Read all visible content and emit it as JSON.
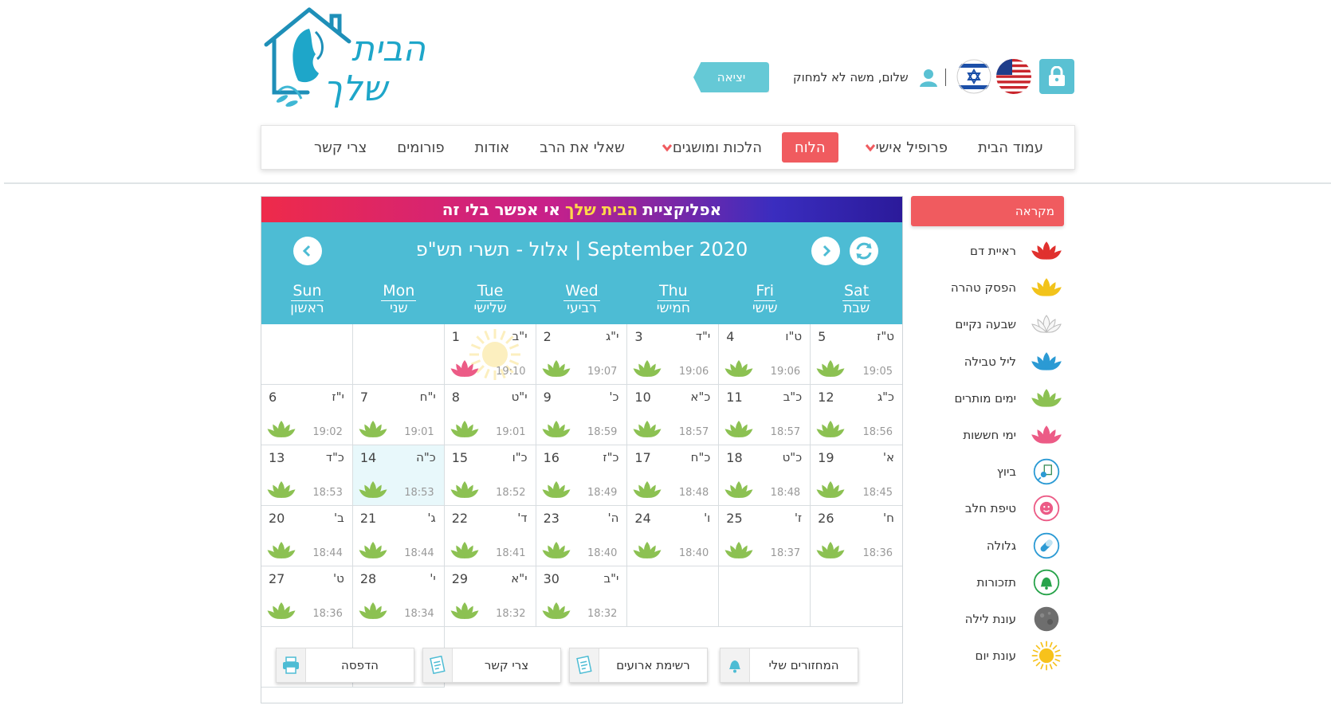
{
  "header": {
    "logo_text_1": "הבית",
    "logo_text_2": "שלך",
    "logout_label": "יציאה",
    "greeting": "שלום, משה לא למחוק"
  },
  "nav": [
    {
      "label": "עמוד הבית",
      "dropdown": false,
      "active": false
    },
    {
      "label": "פרופיל אישי",
      "dropdown": true,
      "active": false
    },
    {
      "label": "הלוח",
      "dropdown": false,
      "active": true
    },
    {
      "label": "הלכות ומושגים",
      "dropdown": true,
      "active": false
    },
    {
      "label": "שאלי את הרב",
      "dropdown": false,
      "active": false
    },
    {
      "label": "אודות",
      "dropdown": false,
      "active": false
    },
    {
      "label": "פורומים",
      "dropdown": false,
      "active": false
    },
    {
      "label": "צרי קשר",
      "dropdown": false,
      "active": false
    }
  ],
  "colors": {
    "accent": "#f05b5f",
    "calendar_header": "#4dbcd4",
    "lotus_green": "#8cc152"
  },
  "banner": {
    "part1": "אפליקציית",
    "highlight": "הבית שלך",
    "part2": "אי אפשר בלי זה"
  },
  "calendar": {
    "title": "אלול - תשרי תש\"פ | September 2020",
    "weekdays": [
      {
        "en": "Sun",
        "he": "ראשון"
      },
      {
        "en": "Mon",
        "he": "שני"
      },
      {
        "en": "Tue",
        "he": "שלישי"
      },
      {
        "en": "Wed",
        "he": "רביעי"
      },
      {
        "en": "Thu",
        "he": "חמישי"
      },
      {
        "en": "Fri",
        "he": "שישי"
      },
      {
        "en": "Sat",
        "he": "שבת"
      }
    ],
    "cells": [
      {
        "empty": true
      },
      {
        "empty": true
      },
      {
        "day": "1",
        "heb": "י\"ב",
        "time": "19:10",
        "lotus": "pink",
        "sun": true
      },
      {
        "day": "2",
        "heb": "י\"ג",
        "time": "19:07",
        "lotus": "green"
      },
      {
        "day": "3",
        "heb": "י\"ד",
        "time": "19:06",
        "lotus": "green"
      },
      {
        "day": "4",
        "heb": "ט\"ו",
        "time": "19:06",
        "lotus": "green"
      },
      {
        "day": "5",
        "heb": "ט\"ז",
        "time": "19:05",
        "lotus": "green"
      },
      {
        "day": "6",
        "heb": "י\"ז",
        "time": "19:02",
        "lotus": "green"
      },
      {
        "day": "7",
        "heb": "י\"ח",
        "time": "19:01",
        "lotus": "green"
      },
      {
        "day": "8",
        "heb": "י\"ט",
        "time": "19:01",
        "lotus": "green"
      },
      {
        "day": "9",
        "heb": "כ'",
        "time": "18:59",
        "lotus": "green"
      },
      {
        "day": "10",
        "heb": "כ\"א",
        "time": "18:57",
        "lotus": "green"
      },
      {
        "day": "11",
        "heb": "כ\"ב",
        "time": "18:57",
        "lotus": "green"
      },
      {
        "day": "12",
        "heb": "כ\"ג",
        "time": "18:56",
        "lotus": "green"
      },
      {
        "day": "13",
        "heb": "כ\"ד",
        "time": "18:53",
        "lotus": "green"
      },
      {
        "day": "14",
        "heb": "כ\"ה",
        "time": "18:53",
        "lotus": "green",
        "today": true
      },
      {
        "day": "15",
        "heb": "כ\"ו",
        "time": "18:52",
        "lotus": "green"
      },
      {
        "day": "16",
        "heb": "כ\"ז",
        "time": "18:49",
        "lotus": "green"
      },
      {
        "day": "17",
        "heb": "כ\"ח",
        "time": "18:48",
        "lotus": "green"
      },
      {
        "day": "18",
        "heb": "כ\"ט",
        "time": "18:48",
        "lotus": "green"
      },
      {
        "day": "19",
        "heb": "א'",
        "time": "18:45",
        "lotus": "green"
      },
      {
        "day": "20",
        "heb": "ב'",
        "time": "18:44",
        "lotus": "green"
      },
      {
        "day": "21",
        "heb": "ג'",
        "time": "18:44",
        "lotus": "green"
      },
      {
        "day": "22",
        "heb": "ד'",
        "time": "18:41",
        "lotus": "green"
      },
      {
        "day": "23",
        "heb": "ה'",
        "time": "18:40",
        "lotus": "green"
      },
      {
        "day": "24",
        "heb": "ו'",
        "time": "18:40",
        "lotus": "green"
      },
      {
        "day": "25",
        "heb": "ז'",
        "time": "18:37",
        "lotus": "green"
      },
      {
        "day": "26",
        "heb": "ח'",
        "time": "18:36",
        "lotus": "green"
      },
      {
        "day": "27",
        "heb": "ט'",
        "time": "18:36",
        "lotus": "green"
      },
      {
        "day": "28",
        "heb": "י'",
        "time": "18:34",
        "lotus": "green"
      },
      {
        "day": "29",
        "heb": "י\"א",
        "time": "18:32",
        "lotus": "green"
      },
      {
        "day": "30",
        "heb": "י\"ב",
        "time": "18:32",
        "lotus": "green"
      },
      {
        "empty": true
      },
      {
        "empty": true
      },
      {
        "empty": true
      },
      {
        "empty": true
      },
      {
        "empty": true
      }
    ]
  },
  "buttons": {
    "print": "הדפסה",
    "contact": "צרי קשר",
    "events": "רשימת ארועים",
    "cycles": "המחזורים שלי"
  },
  "legend": {
    "title": "מקראה",
    "items": [
      {
        "label": "ראיית דם",
        "icon": "lotus-red-icon",
        "color": "#e0312e"
      },
      {
        "label": "הפסק טהרה",
        "icon": "lotus-yellow-icon",
        "color": "#f2c31b"
      },
      {
        "label": "שבעה נקיים",
        "icon": "lotus-white-icon",
        "color": "#f4f4f4"
      },
      {
        "label": "ליל טבילה",
        "icon": "lotus-blue-icon",
        "color": "#2b9ad4"
      },
      {
        "label": "ימים מותרים",
        "icon": "lotus-green-icon",
        "color": "#8cc152"
      },
      {
        "label": "ימי חששות",
        "icon": "lotus-pink-icon",
        "color": "#ec5b86"
      },
      {
        "label": "ביוץ",
        "icon": "ovulation-icon",
        "color": "#2b9ad4"
      },
      {
        "label": "טיפת חלב",
        "icon": "baby-icon",
        "color": "#ec5b86"
      },
      {
        "label": "גלולה",
        "icon": "pill-icon",
        "color": "#2b9ad4"
      },
      {
        "label": "תזכורות",
        "icon": "bell-icon",
        "color": "#27a34a"
      },
      {
        "label": "עונת לילה",
        "icon": "moon-icon",
        "color": "#6e6e6e"
      },
      {
        "label": "עונת יום",
        "icon": "sun-icon",
        "color": "#f7c21b"
      }
    ]
  }
}
